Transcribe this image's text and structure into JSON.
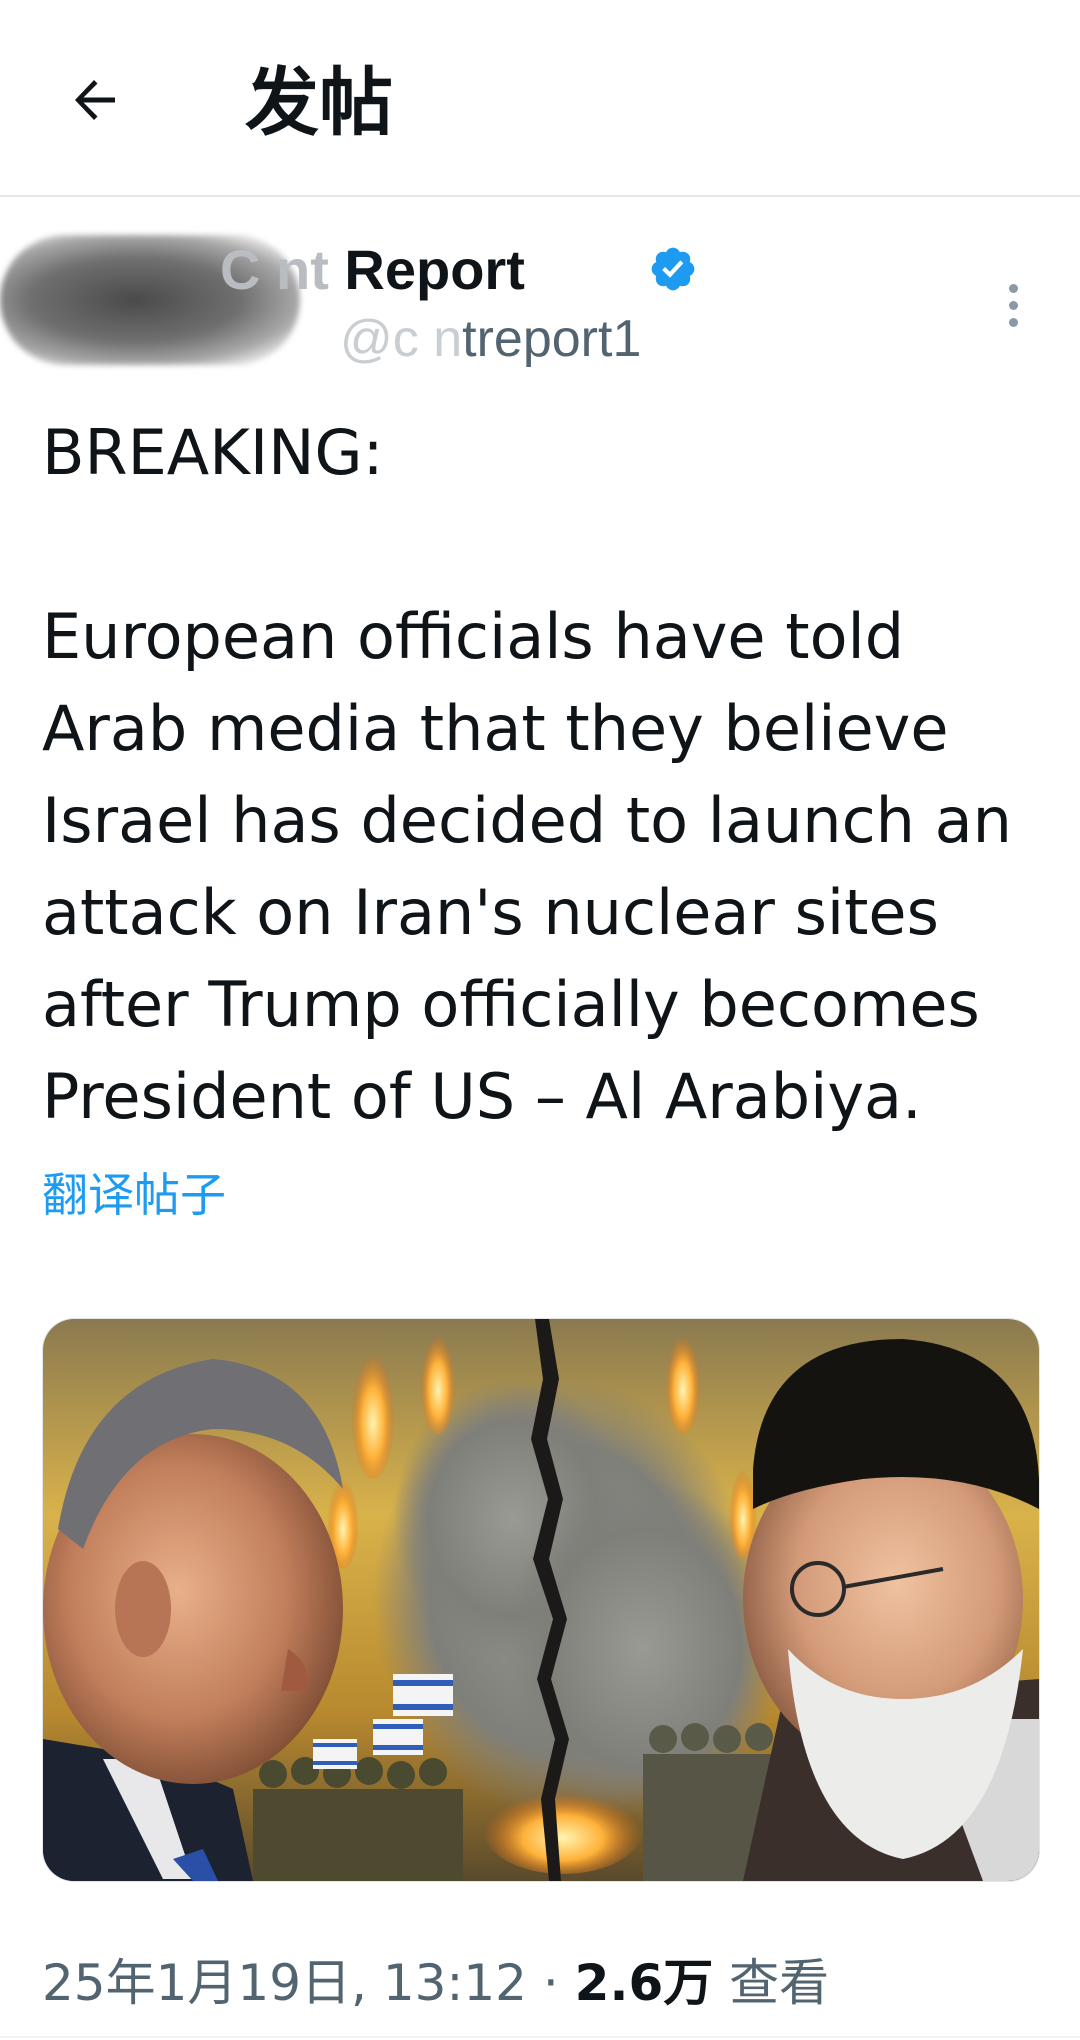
{
  "header": {
    "back_icon": "arrow-left-icon",
    "title": "发帖"
  },
  "author": {
    "name_visible": "Report",
    "name_obscured": "C    nt ",
    "handle_obscured": "@c    n",
    "handle_visible": "treport1",
    "verified_icon": "verified-badge-icon",
    "verified_color": "#1d9bf0",
    "more_icon": "more-vertical-icon"
  },
  "post": {
    "text": "BREAKING:\n\nEuropean officials have told Arab media that they believe Israel has decided to launch an attack on Iran's nuclear sites after Trump officially becomes President of US – Al Arabiya.",
    "translate_label": "翻译帖子",
    "link_color": "#1d9bf0"
  },
  "media": {
    "description_icon": "post-image"
  },
  "meta": {
    "timestamp": "25年1月19日, 13:12",
    "separator": "·",
    "views_count": "2.6万",
    "views_label": "查看"
  }
}
